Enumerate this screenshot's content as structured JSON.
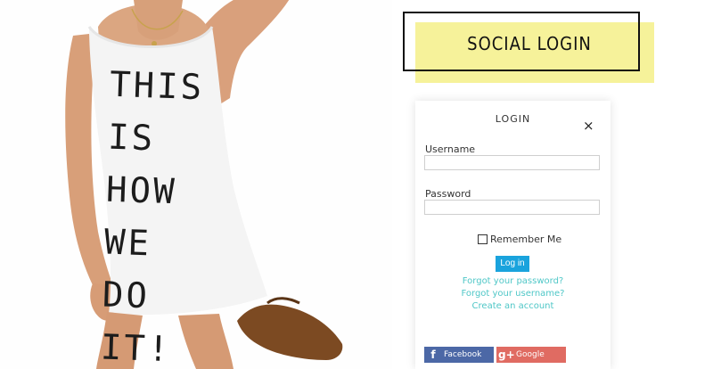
{
  "photo": {
    "shirt_text": "THIS IS\nHOW WE\nDO IT!"
  },
  "hero": {
    "title": "SOCIAL LOGIN",
    "accent_color": "#f6f29a"
  },
  "login_card": {
    "title": "LOGIN",
    "close_symbol": "×",
    "username_label": "Username",
    "username_value": "",
    "password_label": "Password",
    "password_value": "",
    "remember_label": "Remember Me",
    "login_button": "Log in",
    "links": {
      "forgot_password": "Forgot your password?",
      "forgot_username": "Forgot your username?",
      "create_account": "Create an account"
    },
    "social": {
      "facebook_icon": "f",
      "facebook_label": "Facebook",
      "google_icon": "g+",
      "google_label": "Google"
    },
    "colors": {
      "primary": "#1aa3dd",
      "link": "#4fc7c7",
      "facebook": "#4c68a6",
      "google": "#e06b62"
    }
  }
}
